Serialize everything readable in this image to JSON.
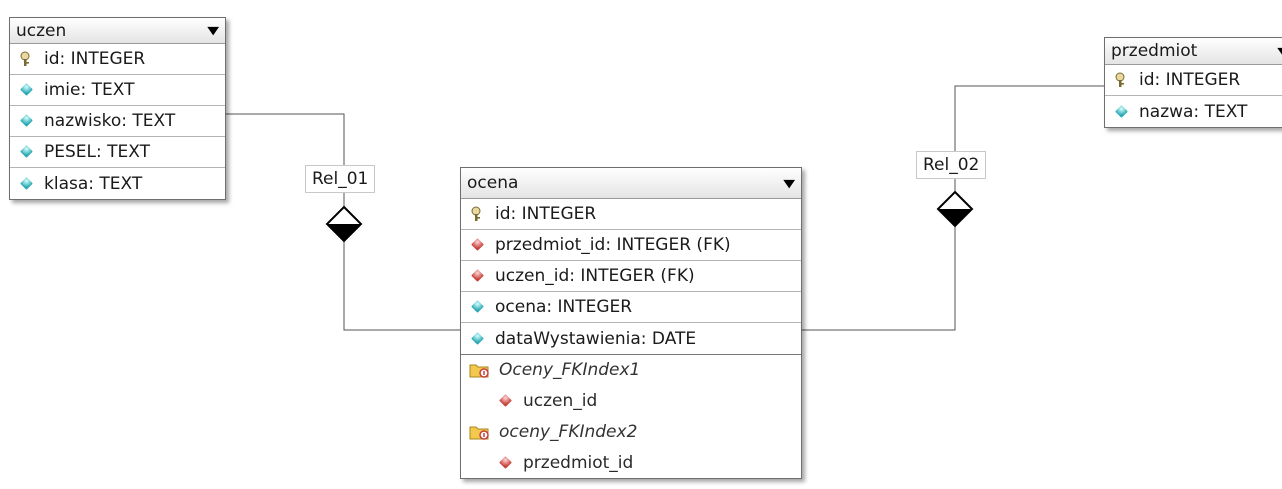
{
  "tables": {
    "uczen": {
      "name": "uczen",
      "fields": [
        "id: INTEGER",
        "imie: TEXT",
        "nazwisko: TEXT",
        "PESEL: TEXT",
        "klasa: TEXT"
      ]
    },
    "ocena": {
      "name": "ocena",
      "fields": [
        "id: INTEGER",
        "przedmiot_id: INTEGER (FK)",
        "uczen_id: INTEGER (FK)",
        "ocena: INTEGER",
        "dataWystawienia: DATE"
      ],
      "indexes": [
        {
          "name": "Oceny_FKIndex1",
          "column": "uczen_id"
        },
        {
          "name": "oceny_FKIndex2",
          "column": "przedmiot_id"
        }
      ]
    },
    "przedmiot": {
      "name": "przedmiot",
      "fields": [
        "id: INTEGER",
        "nazwa: TEXT"
      ]
    }
  },
  "relations": {
    "rel1": "Rel_01",
    "rel2": "Rel_02"
  },
  "icons": {
    "primary_key": "key-icon",
    "attribute": "teal-diamond-icon",
    "foreign_key": "red-diamond-icon",
    "index": "folder-index-icon",
    "collapse": "dropdown-arrow-icon"
  },
  "colors": {
    "attribute": "#2aa9b3",
    "foreign_key": "#c8403a",
    "line": "#555555"
  }
}
